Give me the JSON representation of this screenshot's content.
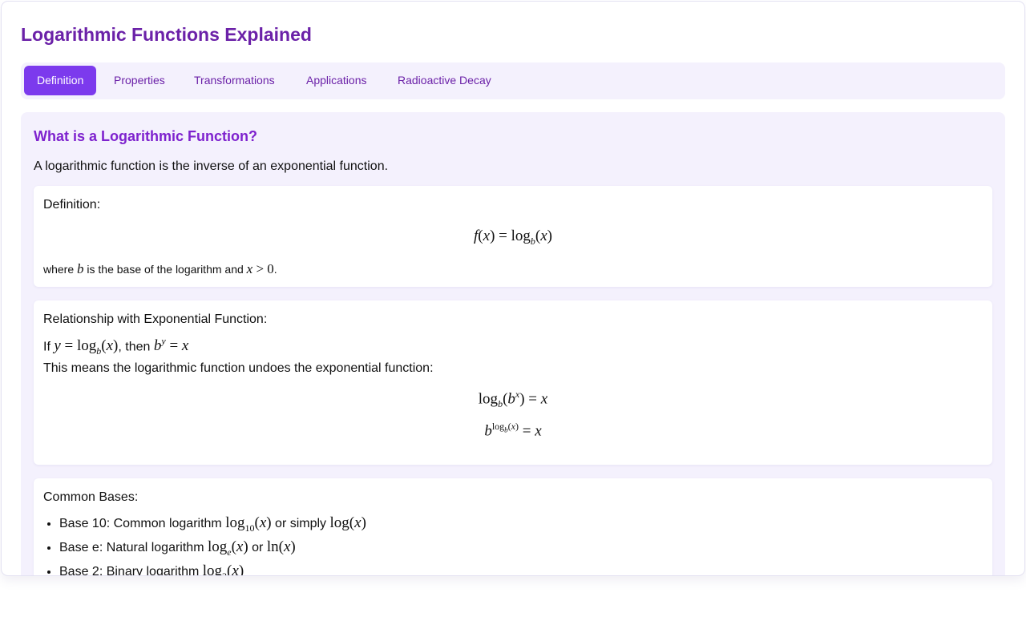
{
  "header": {
    "title": "Logarithmic Functions Explained"
  },
  "tabs": [
    {
      "label": "Definition",
      "active": true
    },
    {
      "label": "Properties",
      "active": false
    },
    {
      "label": "Transformations",
      "active": false
    },
    {
      "label": "Applications",
      "active": false
    },
    {
      "label": "Radioactive Decay",
      "active": false
    }
  ],
  "content": {
    "heading": "What is a Logarithmic Function?",
    "intro": "A logarithmic function is the inverse of an exponential function.",
    "definition_card": {
      "label": "Definition:",
      "note_prefix": "where",
      "note_mid": "is the base of the logarithm and",
      "note_suffix": "."
    },
    "relationship_card": {
      "label": "Relationship with Exponential Function:",
      "if_text": "If",
      "then_text": ", then",
      "means_text": "This means the logarithmic function undoes the exponential function:"
    },
    "bases_card": {
      "label": "Common Bases:",
      "items": [
        {
          "prefix": "Base 10: Common logarithm",
          "connector": "or simply"
        },
        {
          "prefix": "Base e: Natural logarithm",
          "connector": "or"
        },
        {
          "prefix": "Base 2: Binary logarithm",
          "connector": ""
        }
      ]
    }
  },
  "colors": {
    "accent": "#7c3aed",
    "title": "#6b21a8",
    "panel_bg": "#f4f1fd"
  }
}
